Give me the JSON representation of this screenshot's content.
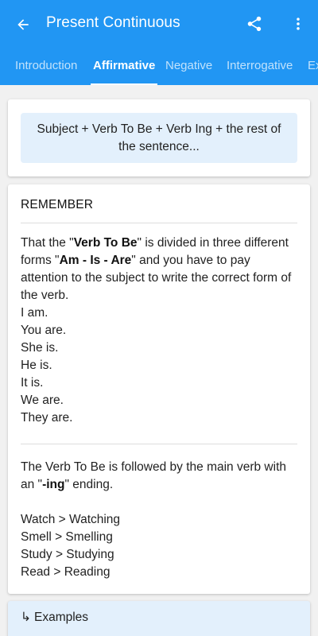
{
  "toolbar": {
    "title": "Present Continuous"
  },
  "tabs": [
    {
      "label": "Introduction",
      "active": false
    },
    {
      "label": "Affirmative",
      "active": true
    },
    {
      "label": "Negative",
      "active": false
    },
    {
      "label": "Interrogative",
      "active": false
    },
    {
      "label": "Ex",
      "active": false
    }
  ],
  "formula": {
    "text": "Subject + Verb To Be + Verb Ing + the rest of the sentence..."
  },
  "remember": {
    "title": "REMEMBER",
    "intro_1": "That the \"",
    "intro_bold_1": "Verb To Be",
    "intro_2": "\" is divided in three different forms \"",
    "intro_bold_2": "Am - Is - Are",
    "intro_3": "\" and you have to pay attention to the subject to write the correct form of the verb.",
    "forms": [
      "I am.",
      "You are.",
      "She is.",
      "He is.",
      "It is.",
      "We are.",
      "They are."
    ],
    "ing_1": "The Verb To Be is followed by the main verb with an \"",
    "ing_bold": "-ing",
    "ing_2": "\" ending.",
    "examples_list": [
      "Watch > Watching",
      "Smell > Smelling",
      "Study > Studying",
      "Read > Reading"
    ]
  },
  "examples": {
    "arrow": "↳",
    "label": "Examples"
  },
  "colors": {
    "primary": "#2196f3",
    "highlight": "#e3f0fc"
  },
  "icons": [
    "back-arrow-icon",
    "share-icon",
    "more-vert-icon"
  ]
}
